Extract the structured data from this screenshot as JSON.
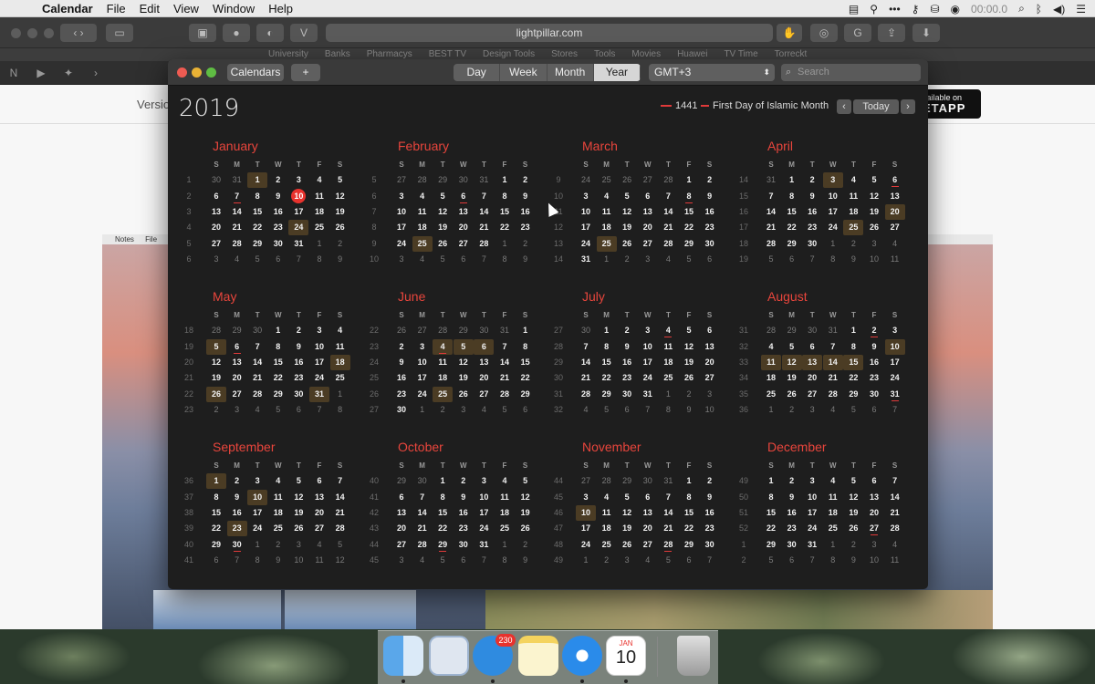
{
  "menubar": {
    "app": "Calendar",
    "items": [
      "File",
      "Edit",
      "View",
      "Window",
      "Help"
    ],
    "timer": "00:00.0"
  },
  "browser": {
    "url": "lightpillar.com",
    "favorites": [
      "University",
      "Banks",
      "Pharmacys",
      "BEST TV",
      "Design Tools",
      "Stores",
      "Tools",
      "Movies",
      "Huawei",
      "TV Time",
      "Torreckt"
    ],
    "page_version": "Versio",
    "setapp_top": "vailable on",
    "setapp_bottom": "ETAPP",
    "notes_label": "Notes",
    "notes_file": "File"
  },
  "calendar": {
    "calendars_button": "Calendars",
    "add_button": "+",
    "views": [
      "Day",
      "Week",
      "Month",
      "Year"
    ],
    "active_view": "Year",
    "timezone": "GMT+3",
    "search_placeholder": "Search",
    "year": "2019",
    "legend": [
      {
        "label": "1441",
        "color": "#e03a3a"
      },
      {
        "label": "First Day of Islamic Month",
        "color": "#e03a3a"
      }
    ],
    "today_button": "Today",
    "weekdays": [
      "S",
      "M",
      "T",
      "W",
      "T",
      "F",
      "S"
    ],
    "months": [
      {
        "name": "January",
        "wk": [
          "1",
          "2",
          "3",
          "4",
          "5",
          "6"
        ],
        "days": [
          30,
          31,
          1,
          2,
          3,
          4,
          5,
          6,
          7,
          8,
          9,
          10,
          11,
          12,
          13,
          14,
          15,
          16,
          17,
          18,
          19,
          20,
          21,
          22,
          23,
          24,
          25,
          26,
          27,
          28,
          29,
          30,
          31,
          1,
          2,
          3,
          4,
          5,
          6,
          7,
          8,
          9
        ],
        "start": 2,
        "hl": [
          1,
          24
        ],
        "ul": [
          7
        ],
        "today": 10
      },
      {
        "name": "February",
        "wk": [
          "5",
          "6",
          "7",
          "8",
          "9",
          "10"
        ],
        "days": [
          27,
          28,
          29,
          30,
          31,
          1,
          2,
          3,
          4,
          5,
          6,
          7,
          8,
          9,
          10,
          11,
          12,
          13,
          14,
          15,
          16,
          17,
          18,
          19,
          20,
          21,
          22,
          23,
          24,
          25,
          26,
          27,
          28,
          1,
          2,
          3,
          4,
          5,
          6,
          7,
          8,
          9
        ],
        "start": 5,
        "hl": [
          25
        ],
        "ul": [
          6
        ],
        "today": 0
      },
      {
        "name": "March",
        "wk": [
          "9",
          "10",
          "11",
          "12",
          "13",
          "14"
        ],
        "days": [
          24,
          25,
          26,
          27,
          28,
          1,
          2,
          3,
          4,
          5,
          6,
          7,
          8,
          9,
          10,
          11,
          12,
          13,
          14,
          15,
          16,
          17,
          18,
          19,
          20,
          21,
          22,
          23,
          24,
          25,
          26,
          27,
          28,
          29,
          30,
          31,
          1,
          2,
          3,
          4,
          5,
          6
        ],
        "start": 5,
        "hl": [
          25
        ],
        "ul": [
          8
        ],
        "today": 0
      },
      {
        "name": "April",
        "wk": [
          "14",
          "15",
          "16",
          "17",
          "18",
          "19"
        ],
        "days": [
          31,
          1,
          2,
          3,
          4,
          5,
          6,
          7,
          8,
          9,
          10,
          11,
          12,
          13,
          14,
          15,
          16,
          17,
          18,
          19,
          20,
          21,
          22,
          23,
          24,
          25,
          26,
          27,
          28,
          29,
          30,
          1,
          2,
          3,
          4,
          5,
          6,
          7,
          8,
          9,
          10,
          11
        ],
        "start": 1,
        "hl": [
          3,
          20,
          25
        ],
        "ul": [
          6
        ],
        "today": 0
      },
      {
        "name": "May",
        "wk": [
          "18",
          "19",
          "20",
          "21",
          "22",
          "23"
        ],
        "days": [
          28,
          29,
          30,
          1,
          2,
          3,
          4,
          5,
          6,
          7,
          8,
          9,
          10,
          11,
          12,
          13,
          14,
          15,
          16,
          17,
          18,
          19,
          20,
          21,
          22,
          23,
          24,
          25,
          26,
          27,
          28,
          29,
          30,
          31,
          1,
          2,
          3,
          4,
          5,
          6,
          7,
          8
        ],
        "start": 3,
        "hl": [
          5,
          18,
          26,
          31
        ],
        "ul": [
          6
        ],
        "today": 0
      },
      {
        "name": "June",
        "wk": [
          "22",
          "23",
          "24",
          "25",
          "26",
          "27"
        ],
        "days": [
          26,
          27,
          28,
          29,
          30,
          31,
          1,
          2,
          3,
          4,
          5,
          6,
          7,
          8,
          9,
          10,
          11,
          12,
          13,
          14,
          15,
          16,
          17,
          18,
          19,
          20,
          21,
          22,
          23,
          24,
          25,
          26,
          27,
          28,
          29,
          30,
          1,
          2,
          3,
          4,
          5,
          6
        ],
        "start": 6,
        "hl": [
          4,
          5,
          6,
          25
        ],
        "ul": [
          4
        ],
        "today": 0
      },
      {
        "name": "July",
        "wk": [
          "27",
          "28",
          "29",
          "30",
          "31",
          "32"
        ],
        "days": [
          30,
          1,
          2,
          3,
          4,
          5,
          6,
          7,
          8,
          9,
          10,
          11,
          12,
          13,
          14,
          15,
          16,
          17,
          18,
          19,
          20,
          21,
          22,
          23,
          24,
          25,
          26,
          27,
          28,
          29,
          30,
          31,
          1,
          2,
          3,
          4,
          5,
          6,
          7,
          8,
          9,
          10
        ],
        "start": 1,
        "hl": [],
        "ul": [
          4
        ],
        "today": 0
      },
      {
        "name": "August",
        "wk": [
          "31",
          "32",
          "33",
          "34",
          "35",
          "36"
        ],
        "days": [
          28,
          29,
          30,
          31,
          1,
          2,
          3,
          4,
          5,
          6,
          7,
          8,
          9,
          10,
          11,
          12,
          13,
          14,
          15,
          16,
          17,
          18,
          19,
          20,
          21,
          22,
          23,
          24,
          25,
          26,
          27,
          28,
          29,
          30,
          31,
          1,
          2,
          3,
          4,
          5,
          6,
          7
        ],
        "start": 4,
        "hl": [
          10,
          11,
          12,
          13,
          14,
          15
        ],
        "ul": [
          2,
          31
        ],
        "today": 0
      },
      {
        "name": "September",
        "wk": [
          "36",
          "37",
          "38",
          "39",
          "40",
          "41"
        ],
        "days": [
          1,
          2,
          3,
          4,
          5,
          6,
          7,
          8,
          9,
          10,
          11,
          12,
          13,
          14,
          15,
          16,
          17,
          18,
          19,
          20,
          21,
          22,
          23,
          24,
          25,
          26,
          27,
          28,
          29,
          30,
          1,
          2,
          3,
          4,
          5,
          6,
          7,
          8,
          9,
          10,
          11,
          12
        ],
        "start": 0,
        "hl": [
          1,
          10,
          23
        ],
        "ul": [
          30
        ],
        "today": 0
      },
      {
        "name": "October",
        "wk": [
          "40",
          "41",
          "42",
          "43",
          "44",
          "45"
        ],
        "days": [
          29,
          30,
          1,
          2,
          3,
          4,
          5,
          6,
          7,
          8,
          9,
          10,
          11,
          12,
          13,
          14,
          15,
          16,
          17,
          18,
          19,
          20,
          21,
          22,
          23,
          24,
          25,
          26,
          27,
          28,
          29,
          30,
          31,
          1,
          2,
          3,
          4,
          5,
          6,
          7,
          8,
          9
        ],
        "start": 2,
        "hl": [],
        "ul": [
          29
        ],
        "today": 0
      },
      {
        "name": "November",
        "wk": [
          "44",
          "45",
          "46",
          "47",
          "48",
          "49"
        ],
        "days": [
          27,
          28,
          29,
          30,
          31,
          1,
          2,
          3,
          4,
          5,
          6,
          7,
          8,
          9,
          10,
          11,
          12,
          13,
          14,
          15,
          16,
          17,
          18,
          19,
          20,
          21,
          22,
          23,
          24,
          25,
          26,
          27,
          28,
          29,
          30,
          1,
          2,
          3,
          4,
          5,
          6,
          7
        ],
        "start": 5,
        "hl": [
          10
        ],
        "ul": [
          28
        ],
        "today": 0
      },
      {
        "name": "December",
        "wk": [
          "49",
          "50",
          "51",
          "52",
          "1",
          "2"
        ],
        "days": [
          1,
          2,
          3,
          4,
          5,
          6,
          7,
          8,
          9,
          10,
          11,
          12,
          13,
          14,
          15,
          16,
          17,
          18,
          19,
          20,
          21,
          22,
          23,
          24,
          25,
          26,
          27,
          28,
          29,
          30,
          31,
          1,
          2,
          3,
          4,
          5,
          6,
          7,
          8,
          9,
          10,
          11
        ],
        "start": 0,
        "hl": [],
        "ul": [
          27
        ],
        "today": 0
      }
    ]
  },
  "dock": {
    "items": [
      "Finder",
      "Mail",
      "Tweetbot",
      "Notes",
      "Safari",
      "Calendar",
      "Trash"
    ],
    "badge": "230",
    "calendar_month": "JAN",
    "calendar_day": "10"
  }
}
